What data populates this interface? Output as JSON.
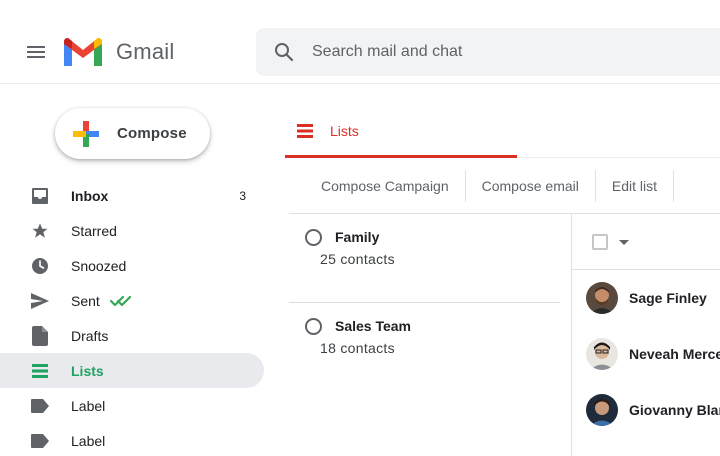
{
  "header": {
    "app_name": "Gmail",
    "search_placeholder": "Search mail and chat"
  },
  "compose": {
    "label": "Compose"
  },
  "sidebar": {
    "items": [
      {
        "label": "Inbox",
        "count": "3",
        "icon": "inbox-icon"
      },
      {
        "label": "Starred",
        "icon": "star-icon"
      },
      {
        "label": "Snoozed",
        "icon": "clock-icon"
      },
      {
        "label": "Sent",
        "icon": "send-icon"
      },
      {
        "label": "Drafts",
        "icon": "draft-icon"
      },
      {
        "label": "Lists",
        "icon": "list-icon",
        "active": true
      },
      {
        "label": "Label",
        "icon": "label-icon"
      },
      {
        "label": "Label",
        "icon": "label-icon"
      }
    ]
  },
  "main": {
    "tab": {
      "label": "Lists"
    },
    "toolbar": {
      "compose_campaign": "Compose Campaign",
      "compose_email": "Compose email",
      "edit_list": "Edit list"
    },
    "lists": [
      {
        "name": "Family",
        "count": "25 contacts"
      },
      {
        "name": "Sales Team",
        "count": "18 contacts"
      }
    ],
    "contacts": [
      {
        "name": "Sage Finley"
      },
      {
        "name": "Neveah Merce"
      },
      {
        "name": "Giovanny Blanc"
      }
    ]
  },
  "colors": {
    "accent_red": "#d93025",
    "active_green": "#1ea362",
    "gmail_red": "#ea4335",
    "gmail_blue": "#4285f4",
    "gmail_yellow": "#fbbc04",
    "gmail_green": "#34a853"
  }
}
